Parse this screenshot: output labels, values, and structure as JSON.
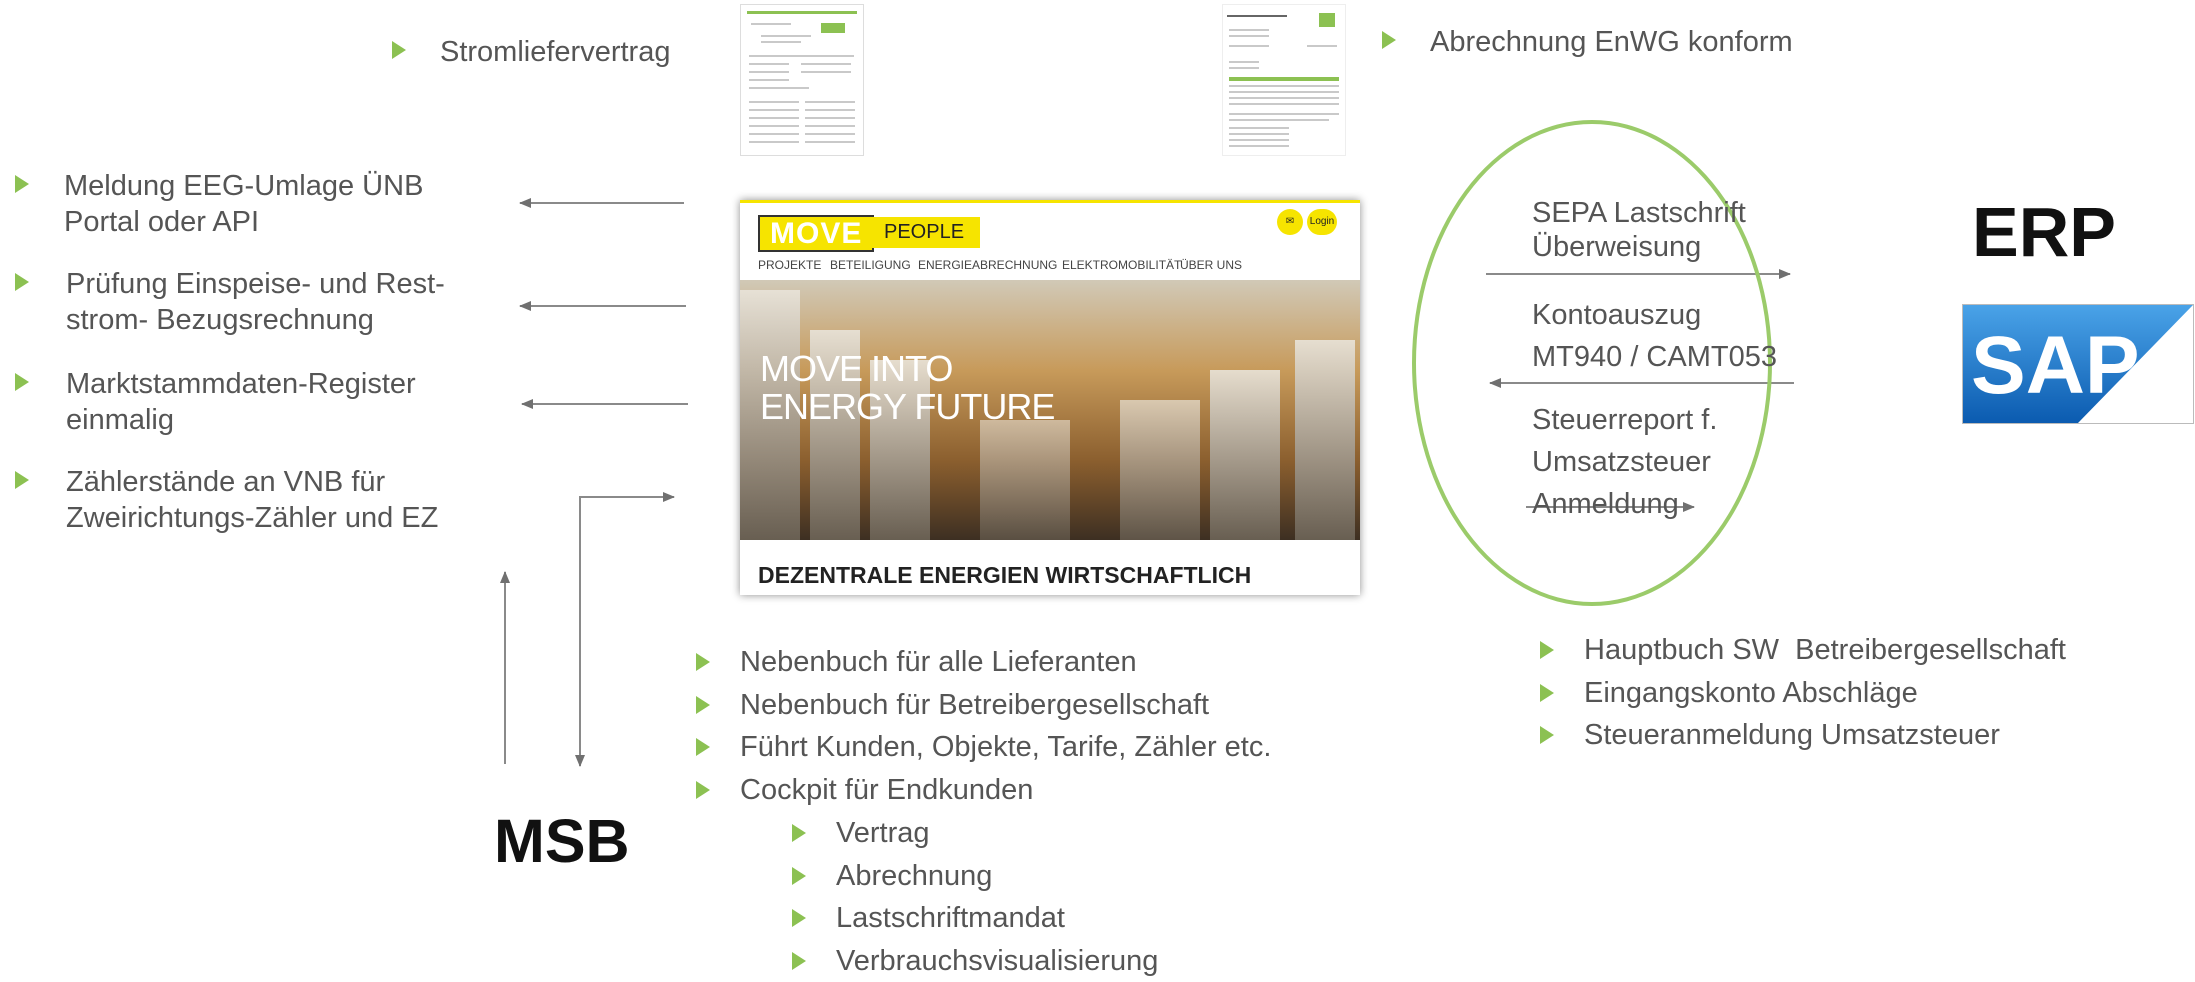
{
  "top": {
    "left_label": "Stromliefervertrag",
    "right_label": "Abrechnung EnWG konform"
  },
  "left_items": [
    "Meldung EEG-Umlage ÜNB Portal oder API",
    "Prüfung Einspeise- und Rest-strom- Bezugsrechnung",
    "Marktstammdaten-Register einmalig",
    "Zählerstände an VNB für Zweirichtungs-Zähler und EZ"
  ],
  "left_items_lines": [
    [
      "Meldung EEG-Umlage ÜNB",
      "Portal oder API"
    ],
    [
      "Prüfung Einspeise- und Rest-",
      "strom- Bezugsrechnung"
    ],
    [
      "Marktstammdaten-Register",
      "einmalig"
    ],
    [
      "Zählerstände an VNB für",
      "Zweirichtungs-Zähler und EZ"
    ]
  ],
  "msb_label": "MSB",
  "erp_label": "ERP",
  "website": {
    "logo_move": "MOVE",
    "logo_people": "PEOPLE",
    "login": "Login",
    "nav": [
      "PROJEKTE",
      "BETEILIGUNG",
      "ENERGIEABRECHNUNG",
      "ELEKTROMOBILITÄT",
      "ÜBER UNS"
    ],
    "hero_line1": "MOVE INTO",
    "hero_line2": "ENERGY FUTURE",
    "footer_title": "DEZENTRALE ENERGIEN WIRTSCHAFTLICH"
  },
  "circle": {
    "t1a": "SEPA Lastschrift",
    "t1b": "Überweisung",
    "t2a": "Kontoauszug",
    "t2b": "MT940 / CAMT053",
    "t3a": "Steuerreport f.",
    "t3b": "Umsatzsteuer",
    "t3c": "Anmeldung"
  },
  "center_list": [
    "Nebenbuch für alle Lieferanten",
    "Nebenbuch für Betreibergesellschaft",
    "Führt Kunden, Objekte, Tarife, Zähler etc.",
    "Cockpit für Endkunden"
  ],
  "sub_list": [
    "Vertrag",
    "Abrechnung",
    "Lastschriftmandat",
    "Verbrauchsvisualisierung"
  ],
  "right_list": [
    "Hauptbuch SW  Betreibergesellschaft",
    "Eingangskonto Abschläge",
    "Steueranmeldung Umsatzsteuer"
  ],
  "sap_logo": "SAP",
  "colors": {
    "accent": "#8cc152",
    "circle": "#9bcb6a",
    "yellow": "#f6e400",
    "sap_blue": "#1a6fc4"
  }
}
